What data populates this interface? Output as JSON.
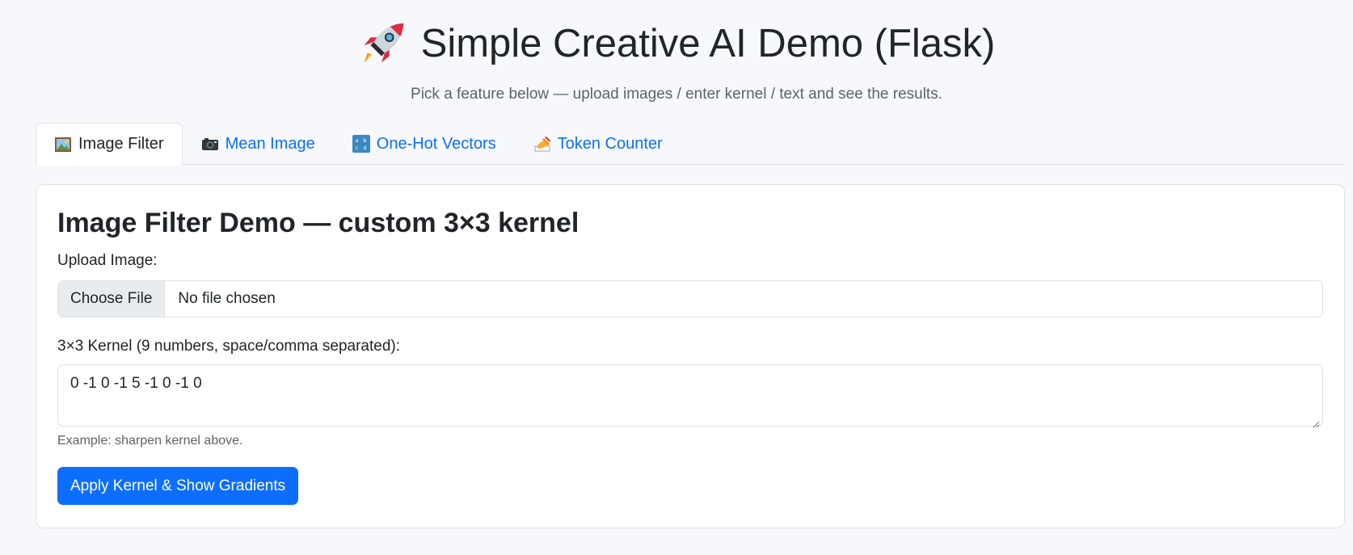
{
  "header": {
    "title": "Simple Creative AI Demo (Flask)",
    "subtitle": "Pick a feature below — upload images / enter kernel / text and see the results.",
    "icon": "rocket-icon"
  },
  "tabs": [
    {
      "label": "Image Filter",
      "icon": "framed-picture-icon",
      "active": true
    },
    {
      "label": "Mean Image",
      "icon": "camera-icon",
      "active": false
    },
    {
      "label": "One-Hot Vectors",
      "icon": "abcd-input-icon",
      "active": false
    },
    {
      "label": "Token Counter",
      "icon": "writing-hand-icon",
      "active": false
    }
  ],
  "card": {
    "title": "Image Filter Demo — custom 3×3 kernel",
    "upload_label": "Upload Image:",
    "file_button": "Choose File",
    "file_status": "No file chosen",
    "kernel_label": "3×3 Kernel (9 numbers, space/comma separated):",
    "kernel_value": "0 -1 0 -1 5 -1 0 -1 0",
    "hint": "Example: sharpen kernel above.",
    "submit": "Apply Kernel & Show Gradients"
  },
  "colors": {
    "primary": "#0d6efd",
    "background": "#f7f8fb",
    "border": "#dee2e6"
  }
}
